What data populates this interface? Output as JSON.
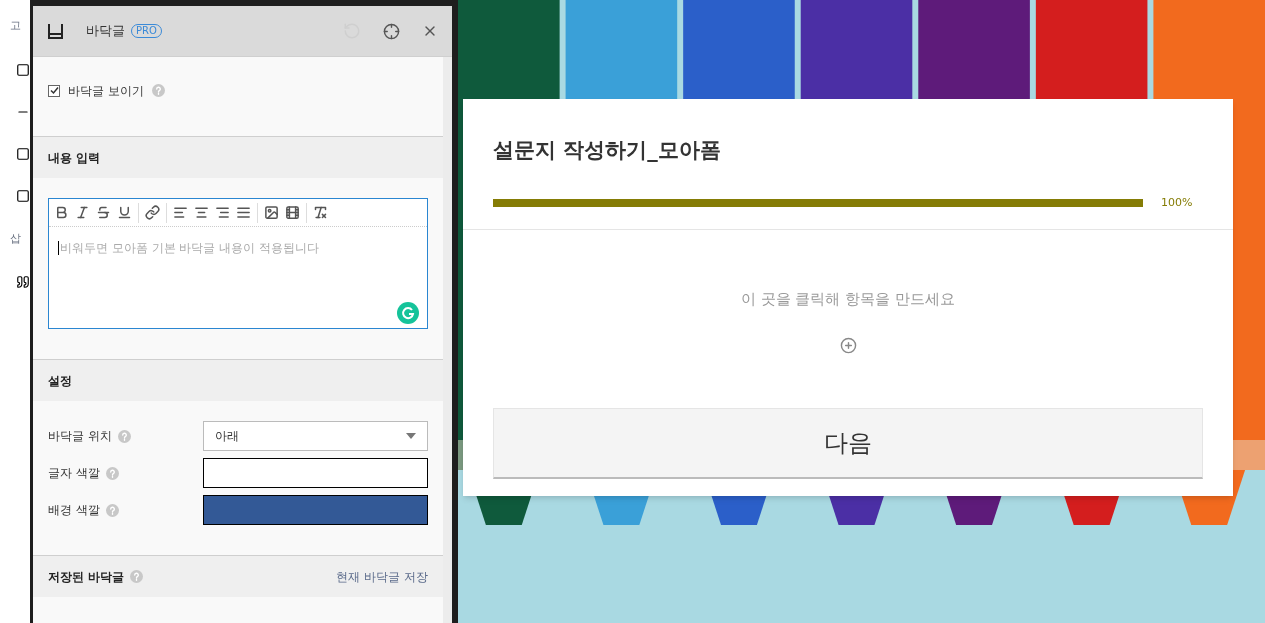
{
  "sidebar": {
    "labels": [
      "고",
      "삽"
    ]
  },
  "panel": {
    "title": "바닥글",
    "badge": "PRO",
    "show_footer": {
      "label": "바닥글 보이기",
      "checked": true
    },
    "content_section": {
      "heading": "내용 입력",
      "editor": {
        "placeholder": "비워두면 모아폼 기본 바닥글 내용이 적용됩니다"
      }
    },
    "settings": {
      "heading": "설정",
      "rows": [
        {
          "kind": "select",
          "label": "바닥글 위치",
          "value": "아래"
        },
        {
          "kind": "color",
          "label": "글자 색깔",
          "color": "#ffffff"
        },
        {
          "kind": "color",
          "label": "배경 색깔",
          "color": "#335996"
        }
      ]
    },
    "saved": {
      "heading": "저장된 바닥글",
      "link": "현재 바닥글 저장"
    }
  },
  "form": {
    "title": "설문지 작성하기_모아폼",
    "progress": {
      "level": 1,
      "reading": "100%"
    },
    "hint": "이 곳을 클릭해 항목을 만드세요",
    "button": "다음"
  }
}
